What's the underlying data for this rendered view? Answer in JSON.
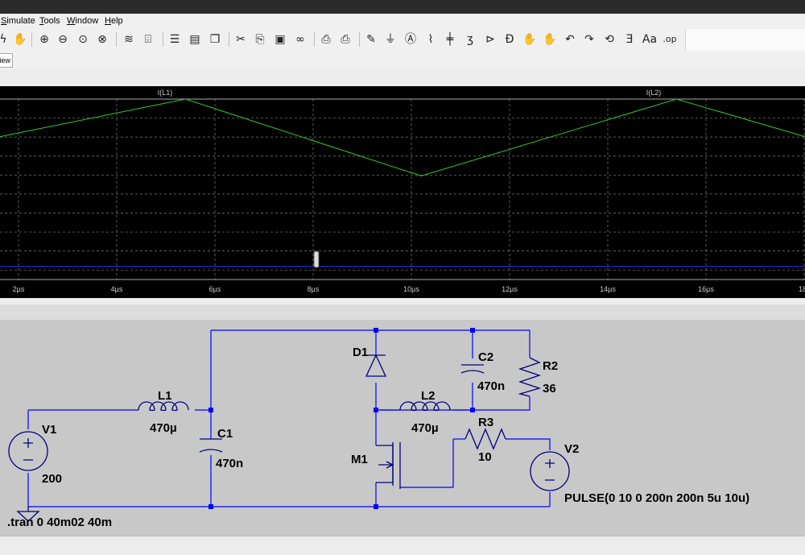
{
  "menu": {
    "items": [
      {
        "label": "Simulate",
        "key": "S"
      },
      {
        "label": "Tools",
        "key": "T"
      },
      {
        "label": "Window",
        "key": "W"
      },
      {
        "label": "Help",
        "key": "H"
      }
    ]
  },
  "toolbar": {
    "icons": [
      "probe-icon",
      "pan-hand-icon",
      "zoom-in-icon",
      "zoom-out-icon",
      "zoom-fit-icon",
      "zoom-cancel-icon",
      "autorange-icon",
      "zoom-full-icon",
      "tile-horizontal-icon",
      "tile-vertical-icon",
      "cascade-icon",
      "cut-icon",
      "copy-icon",
      "paste-icon",
      "find-icon",
      "print-setup-icon",
      "print-icon",
      "draw-wire-icon",
      "ground-icon",
      "label-net-icon",
      "resistor-icon",
      "capacitor-icon",
      "inductor-icon",
      "diode-icon",
      "component-icon",
      "move-icon",
      "drag-icon",
      "undo-icon",
      "redo-icon",
      "rotate-icon",
      "mirror-icon",
      "text-icon",
      "spice-directive-icon"
    ]
  },
  "tab": {
    "label": "iew"
  },
  "waveform": {
    "trace_labels": [
      {
        "text": "I(L1)",
        "color": "#2233ff"
      },
      {
        "text": "I(L2)",
        "color": "#2ecc2e"
      }
    ],
    "x_ticks": [
      "2µs",
      "4µs",
      "6µs",
      "8µs",
      "10µs",
      "12µs",
      "14µs",
      "16µs",
      "18"
    ],
    "colors": {
      "background": "#000000",
      "grid": "#808080",
      "trace_l2": "#2ecc2e",
      "trace_l1": "#2233ff"
    }
  },
  "chart_data": {
    "type": "line",
    "xlabel": "",
    "ylabel": "",
    "x_unit": "µs",
    "xlim": [
      0.5,
      18
    ],
    "grid": true,
    "series": [
      {
        "name": "I(L2)",
        "color": "#2ecc2e",
        "x": [
          0.5,
          5.4,
          10.2,
          15.4,
          18
        ],
        "y_rel": [
          0.78,
          1.0,
          0.55,
          1.0,
          0.78
        ]
      },
      {
        "name": "I(L1)",
        "color": "#2233ff",
        "x": [
          0.5,
          18
        ],
        "y_rel": [
          0.02,
          0.02
        ]
      }
    ]
  },
  "schematic": {
    "components": {
      "v1": {
        "name": "V1",
        "value": "200"
      },
      "l1": {
        "name": "L1",
        "value": "470µ"
      },
      "c1": {
        "name": "C1",
        "value": "470n"
      },
      "d1": {
        "name": "D1"
      },
      "c2": {
        "name": "C2",
        "value": "470n"
      },
      "r2": {
        "name": "R2",
        "value": "36"
      },
      "l2": {
        "name": "L2",
        "value": "470µ"
      },
      "r3": {
        "name": "R3",
        "value": "10"
      },
      "m1": {
        "name": "M1"
      },
      "v2": {
        "name": "V2",
        "value": "PULSE(0 10 0 200n 200n 5u 10u)"
      }
    },
    "directive": ".tran 0 40m02 40m",
    "colors": {
      "wire": "#0000ff",
      "junction": "#0000ff",
      "component": "#000080",
      "text": "#000000"
    }
  }
}
